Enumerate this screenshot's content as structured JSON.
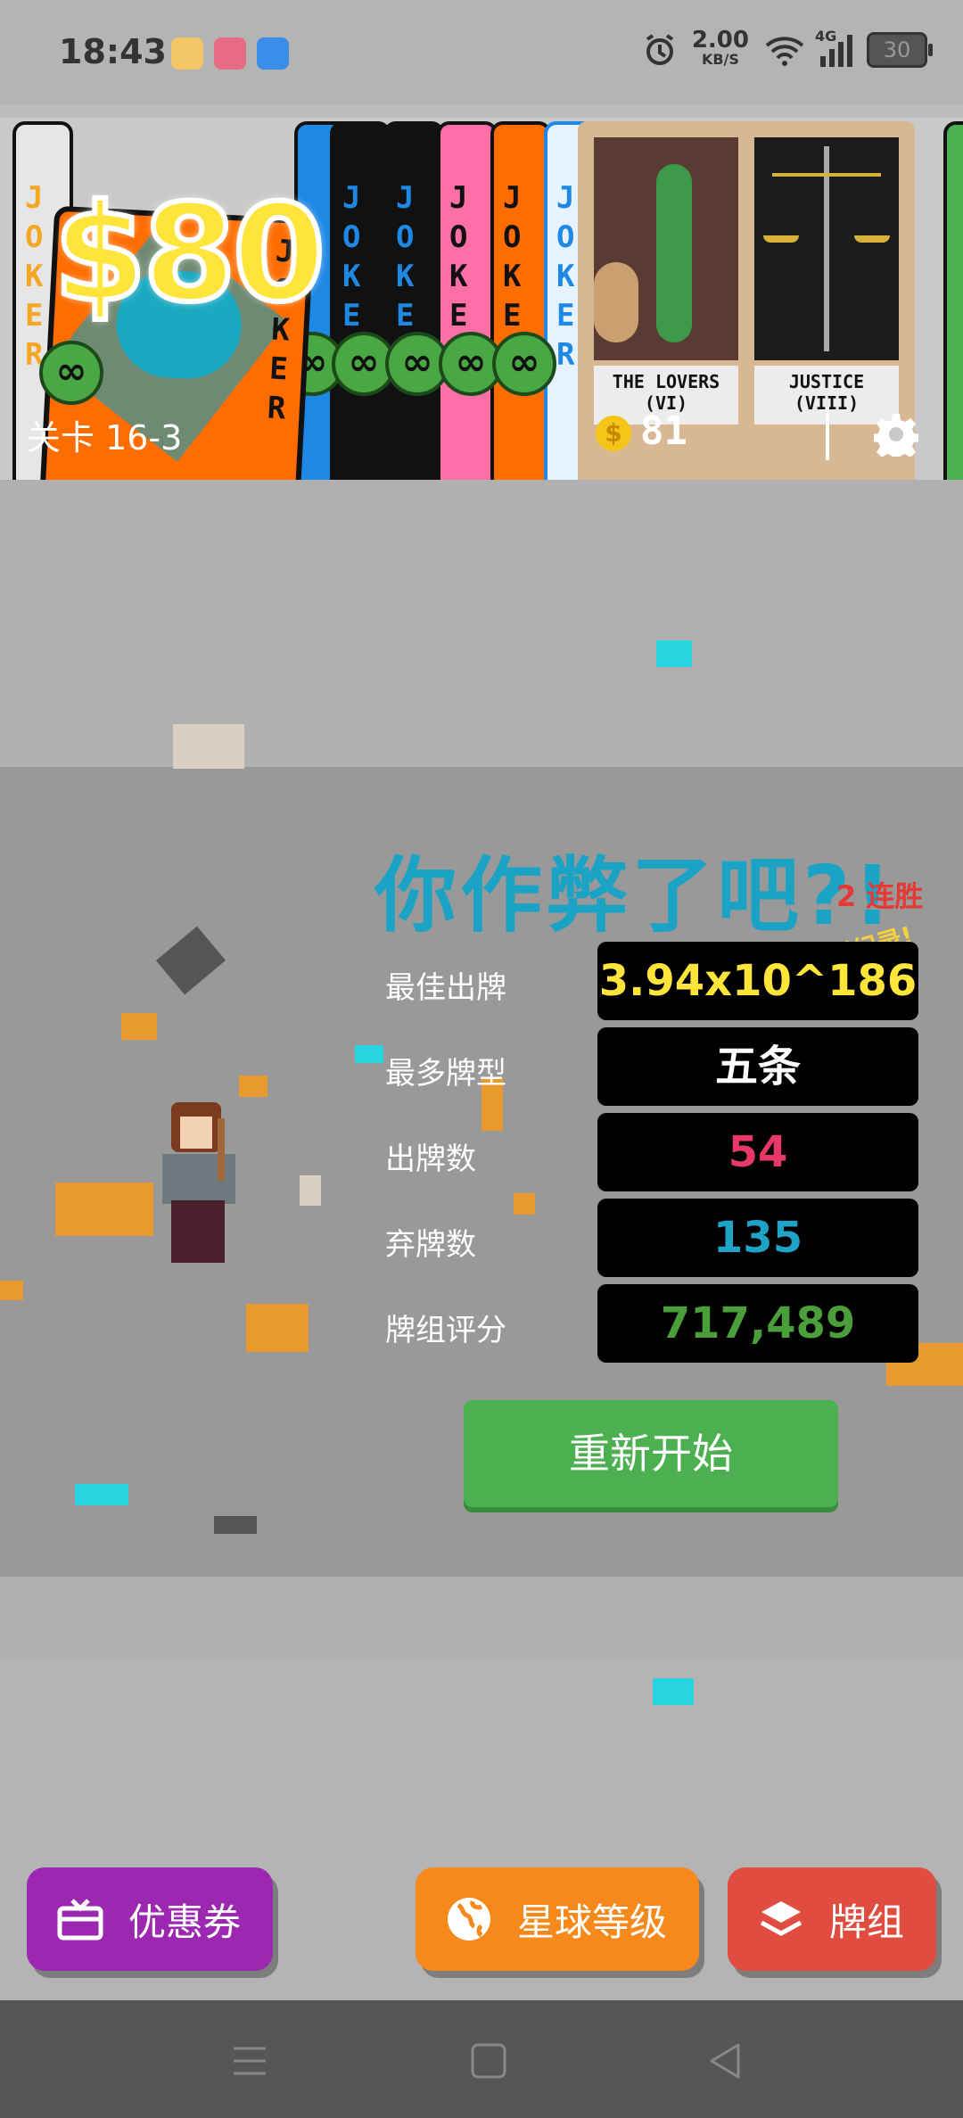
{
  "status_bar": {
    "time": "18:43",
    "net_speed": "2.00",
    "net_unit": "KB/S",
    "network": "4G",
    "battery": "30"
  },
  "jokers": {
    "label": "JOKER",
    "price": "$80",
    "badge": "∞",
    "tarot_lovers": "THE LOVERS (VI)",
    "tarot_justice": "JUSTICE (VIII)"
  },
  "hud": {
    "stage": "关卡 16-3",
    "money": "81"
  },
  "results": {
    "headline": "你作弊了吧?!",
    "streak": "2 连胜",
    "new_record": "新纪录!",
    "rows": [
      {
        "label": "最佳出牌",
        "value": "3.94x10^186",
        "color": "#ffe43b"
      },
      {
        "label": "最多牌型",
        "value": "五条",
        "color": "#ffffff"
      },
      {
        "label": "出牌数",
        "value": "54",
        "color": "#e8386a"
      },
      {
        "label": "弃牌数",
        "value": "135",
        "color": "#1fa3c7"
      },
      {
        "label": "牌组评分",
        "value": "717,489",
        "color": "#4a9f3b"
      }
    ],
    "restart": "重新开始"
  },
  "buttons": {
    "coupon": "优惠券",
    "planet": "星球等级",
    "deck": "牌组"
  },
  "colors": {
    "coupon": "#9c27b0",
    "planet": "#f5891b",
    "deck": "#e04c40"
  }
}
